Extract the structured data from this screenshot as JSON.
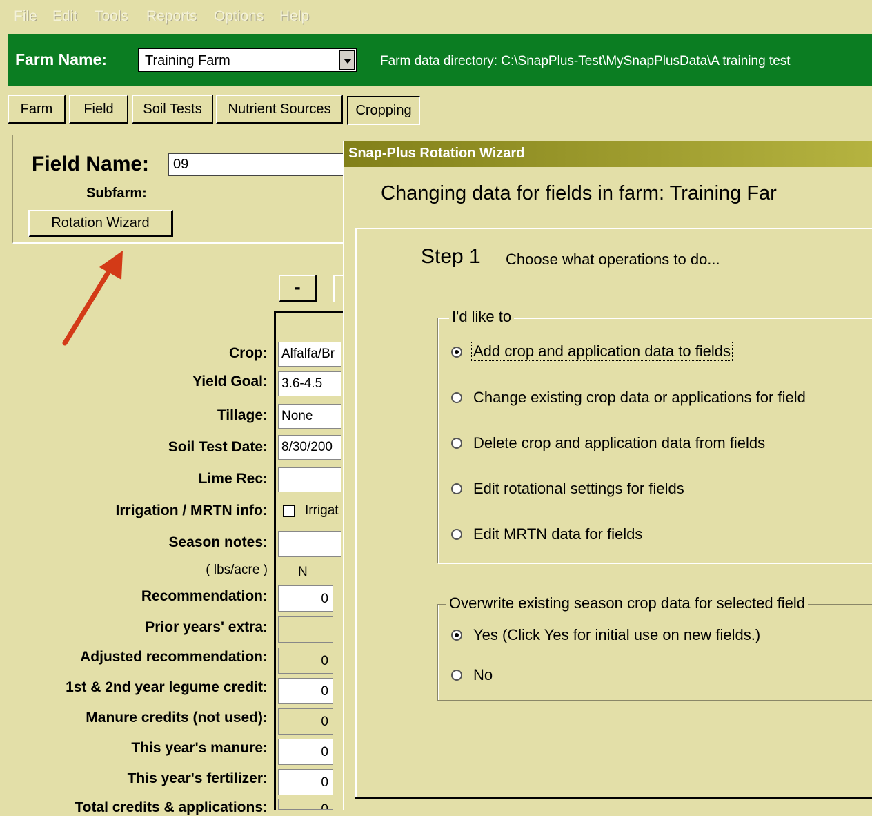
{
  "menu": [
    "File",
    "Edit",
    "Tools",
    "Reports",
    "Options",
    "Help"
  ],
  "farm": {
    "label": "Farm Name:",
    "value": "Training Farm",
    "directory": "Farm data directory: C:\\SnapPlus-Test\\MySnapPlusData\\A training test"
  },
  "tabs": [
    "Farm",
    "Field",
    "Soil Tests",
    "Nutrient Sources",
    "Cropping"
  ],
  "field": {
    "name_label": "Field Name:",
    "name_value": "09",
    "subfarm_label": "Subfarm:",
    "rotation_button": "Rotation Wizard"
  },
  "grid": {
    "minus_button": "-",
    "labels": {
      "crop": "Crop:",
      "yield_goal": "Yield Goal:",
      "tillage": "Tillage:",
      "soil_test_date": "Soil Test Date:",
      "lime_rec": "Lime Rec:",
      "irrigation": "Irrigation / MRTN info:",
      "season_notes": "Season notes:",
      "units": "( lbs/acre )",
      "recommendation": "Recommendation:",
      "prior_years": "Prior years' extra:",
      "adjusted": "Adjusted recommendation:",
      "legume_credit": "1st & 2nd year legume credit:",
      "manure_credits": "Manure credits (not used):",
      "this_year_manure": "This year's manure:",
      "this_year_fertilizer": "This year's fertilizer:",
      "total": "Total credits & applications:"
    },
    "values": {
      "crop": "Alfalfa/Br",
      "yield_goal": "3.6-4.5",
      "tillage": "None",
      "soil_test_date": "8/30/200",
      "lime_rec": "",
      "irrigation_checkbox_label": "Irrigat",
      "season_notes": "",
      "n_header": "N",
      "recommendation": "0",
      "prior_years": "",
      "adjusted": "0",
      "legume_credit": "0",
      "manure_credits": "0",
      "this_year_manure": "0",
      "this_year_fertilizer": "0",
      "total": "0"
    }
  },
  "wizard": {
    "title": "Snap-Plus Rotation Wizard",
    "heading": "Changing data for fields in farm: Training Far",
    "step_number": "Step 1",
    "step_description": "Choose what operations to do...",
    "group1_legend": "I'd like to",
    "options": [
      "Add crop and application data to fields",
      "Change existing crop data or applications for field",
      "Delete crop and application data from fields",
      "Edit rotational settings for fields",
      "Edit MRTN data for fields"
    ],
    "selected_option_index": 0,
    "group2_legend": "Overwrite existing season crop data for selected field",
    "overwrite_yes": "Yes   (Click Yes for initial use on new fields.)",
    "overwrite_no": "No",
    "overwrite_selected": "Yes"
  },
  "colors": {
    "background": "#e3dfa8",
    "farm_bar": "#0b7d22",
    "title_bar": "#828019",
    "arrow": "#d33a17"
  }
}
